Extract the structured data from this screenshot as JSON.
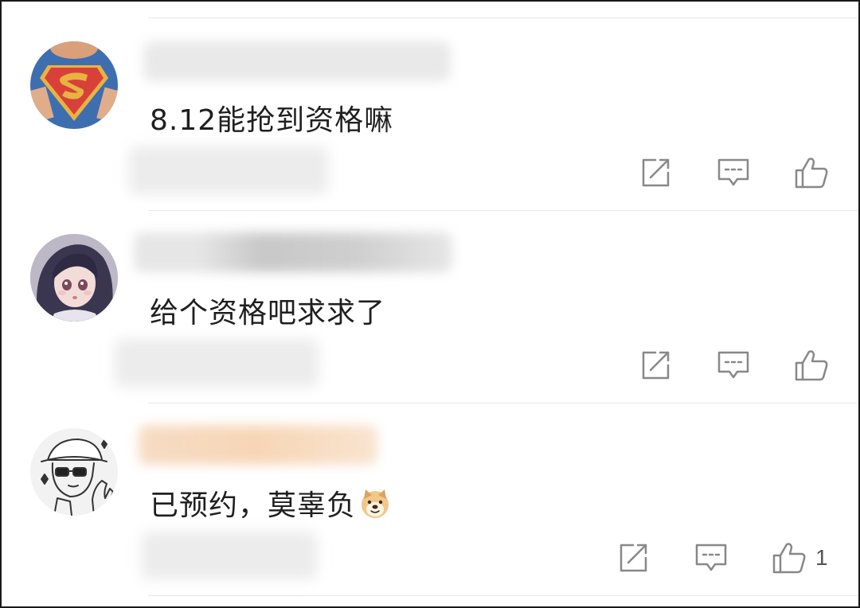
{
  "comments": [
    {
      "text": "8.12能抢到资格嘛",
      "avatar_icon": "superman-avatar",
      "like_count": ""
    },
    {
      "text": "给个资格吧求求了",
      "avatar_icon": "anime-girl-avatar",
      "like_count": ""
    },
    {
      "text": "已预约，莫辜负",
      "emoji_icon": "doge-emoji",
      "avatar_icon": "sketch-cap-sunglasses-avatar",
      "like_count": "1"
    }
  ],
  "icons": {
    "share": "share-icon",
    "reply": "comment-icon",
    "like": "thumbs-up-icon"
  },
  "colors": {
    "icon_gray": "#888888",
    "divider": "#e6e6e6",
    "text": "#1f1f1f"
  }
}
